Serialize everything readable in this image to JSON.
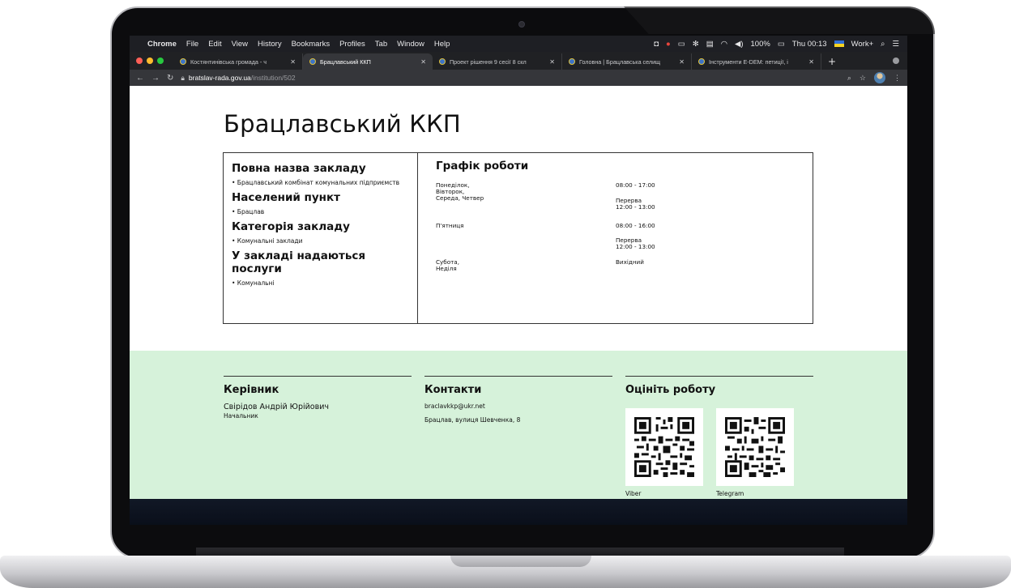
{
  "menubar": {
    "app": "Chrome",
    "items": [
      "File",
      "Edit",
      "View",
      "History",
      "Bookmarks",
      "Profiles",
      "Tab",
      "Window",
      "Help"
    ],
    "status": {
      "bluetooth": "✻",
      "battery": "100%",
      "clock": "Thu 00:13",
      "profile": "Work+"
    }
  },
  "tabs": [
    {
      "title": "Костянтинівська громада - ч",
      "active": false
    },
    {
      "title": "Брацлавський ККП",
      "active": true
    },
    {
      "title": "Проект рішення 9 сесії 8 скл",
      "active": false
    },
    {
      "title": "Головна | Брацлавська селищ",
      "active": false
    },
    {
      "title": "Інструменти E-DEM: петиції, і",
      "active": false
    }
  ],
  "address": {
    "host": "bratslav-rada.gov.ua",
    "path": "/institution/502"
  },
  "page": {
    "title": "Брацлавський ККП",
    "left": {
      "full_name_heading": "Повна назва закладу",
      "full_name_value": "• Брацлавський комбінат комунальних підприємств",
      "locality_heading": "Населений пункт",
      "locality_value": "• Брацлав",
      "category_heading": "Категорія закладу",
      "category_value": "• Комунальні заклади",
      "services_heading": "У закладі надаються послуги",
      "services_value": "• Комунальні"
    },
    "schedule": {
      "heading": "Графік роботи",
      "mon_thu": "Понеділок, Вівторок, Середа, Четвер",
      "mon_thu_hours": "08:00 - 17:00",
      "mon_thu_break": "Перерва 12:00 - 13:00",
      "fri": "П'ятниця",
      "fri_hours": "08:00 - 16:00",
      "fri_break": "Перерва 12:00 - 13:00",
      "weekend": "Субота, Неділя",
      "weekend_value": "Вихідний"
    }
  },
  "footer": {
    "head_heading": "Керівник",
    "head_name": "Свірідов Андрій Юрійович",
    "head_position": "Начальник",
    "contacts_heading": "Контакти",
    "email": "braclavkkp@ukr.net",
    "address": "Брацлав, вулиця Шевченка, 8",
    "rate_heading": "Оцініть роботу",
    "qr_viber_label": "Viber",
    "qr_telegram_label": "Telegram"
  },
  "colors": {
    "footer_bg": "#d6f2da",
    "chrome_dark": "#202124"
  }
}
